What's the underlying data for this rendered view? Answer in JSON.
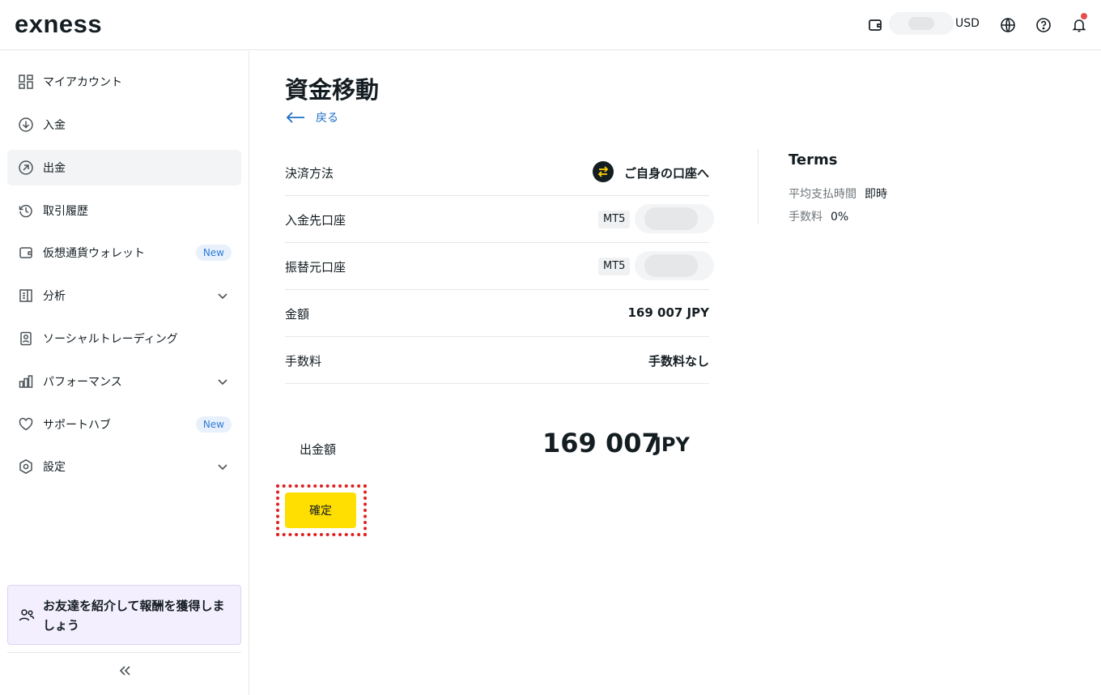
{
  "header": {
    "logo": "exness",
    "currency": "USD",
    "icons": [
      "wallet-icon",
      "globe-icon",
      "help-icon",
      "bell-icon"
    ]
  },
  "sidebar": {
    "items": [
      {
        "label": "マイアカウント",
        "icon": "dashboard-icon"
      },
      {
        "label": "入金",
        "icon": "deposit-icon"
      },
      {
        "label": "出金",
        "icon": "withdraw-icon",
        "active": true
      },
      {
        "label": "取引履歴",
        "icon": "history-icon"
      },
      {
        "label": "仮想通貨ウォレット",
        "icon": "wallet-icon",
        "badge": "New"
      },
      {
        "label": "分析",
        "icon": "analytics-icon",
        "expandable": true
      },
      {
        "label": "ソーシャルトレーディング",
        "icon": "social-trading-icon"
      },
      {
        "label": "パフォーマンス",
        "icon": "performance-icon",
        "expandable": true
      },
      {
        "label": "サポートハブ",
        "icon": "heart-icon",
        "badge": "New"
      },
      {
        "label": "設定",
        "icon": "settings-icon",
        "expandable": true
      }
    ],
    "promo": "お友達を紹介して報酬を獲得しましょう"
  },
  "main": {
    "title": "資金移動",
    "back_label": "戻る",
    "details": [
      {
        "key": "決済方法",
        "value": "ご自身の口座へ"
      },
      {
        "key": "入金先口座",
        "tag": "MT5"
      },
      {
        "key": "振替元口座",
        "tag": "MT5"
      },
      {
        "key": "金額",
        "value": "169 007 JPY"
      },
      {
        "key": "手数料",
        "value": "手数料なし"
      }
    ],
    "total_label": "出金額",
    "total_amount": "169 007",
    "total_currency": "JPY",
    "confirm_label": "確定"
  },
  "terms": {
    "title": "Terms",
    "rows": [
      {
        "key": "平均支払時間",
        "value": "即時"
      },
      {
        "key": "手数料",
        "value": "0%"
      }
    ]
  },
  "colors": {
    "accent": "#ffde02",
    "link": "#1f6fc6",
    "badge_bg": "#e8f1fb",
    "promo_bg": "#f4effe",
    "highlight": "#e01f1f"
  }
}
